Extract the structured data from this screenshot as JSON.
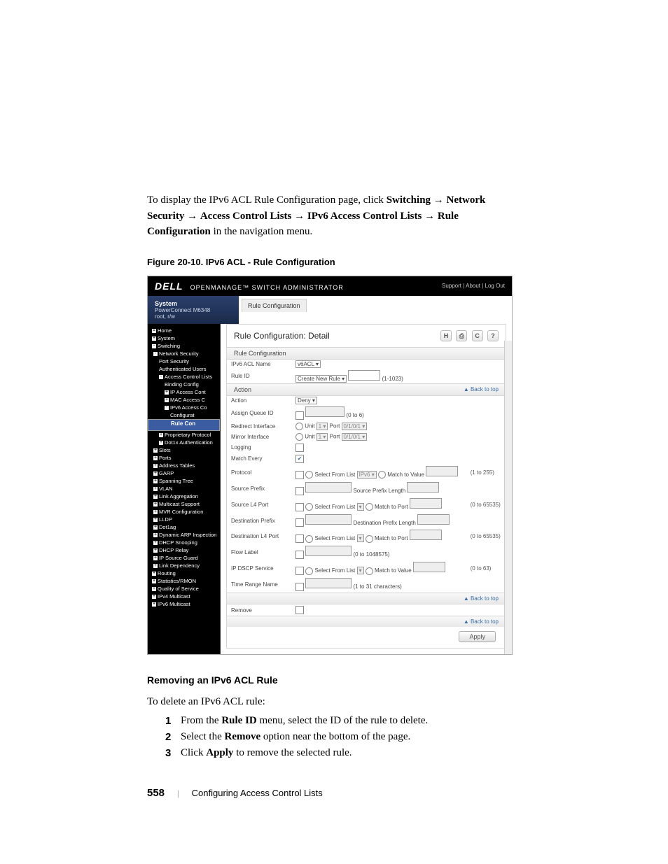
{
  "intro": {
    "line1_prefix": "To display the IPv6 ACL Rule Configuration page, click ",
    "switching": "Switching",
    "arrow": " → ",
    "ns": "Network Security",
    "acl": "Access Control Lists",
    "ipv6": "IPv6 Access Control Lists",
    "rc": "Rule Configuration",
    "suffix": " in the navigation menu."
  },
  "figure_caption": "Figure 20-10.    IPv6 ACL - Rule Configuration",
  "shot": {
    "logo": "DELL",
    "mast": "OPENMANAGE™ SWITCH ADMINISTRATOR",
    "toplinks": "Support | About | Log Out",
    "sys_title": "System",
    "sys_sub": "PowerConnect M6348\nroot, r/w",
    "crumb": "Rule Configuration",
    "panel_title": "Rule Configuration: Detail",
    "icons": {
      "h": "H",
      "print": "⎙",
      "refresh": "C",
      "help": "?"
    },
    "sec1": "Rule Configuration",
    "aclname_label": "IPv6 ACL Name",
    "aclname_value": "v6ACL",
    "ruleid_label": "Rule ID",
    "ruleid_value": "Create New Rule",
    "ruleid_hint": "(1-1023)",
    "sec2": "Action",
    "back_to_top": "▲ Back to top",
    "rows": {
      "action": {
        "label": "Action",
        "value": "Deny"
      },
      "assign_q": {
        "label": "Assign Queue ID",
        "hint": "(0 to 6)"
      },
      "redir": {
        "label": "Redirect Interface",
        "unit": "Unit",
        "port": "Port",
        "portval": "0/1/0/1"
      },
      "mirror": {
        "label": "Mirror Interface",
        "unit": "Unit",
        "port": "Port",
        "portval": "0/1/0/1"
      },
      "logging": {
        "label": "Logging"
      },
      "matchevery": {
        "label": "Match Every"
      },
      "protocol": {
        "label": "Protocol",
        "sfl": "Select From List",
        "sflval": "IPv6",
        "mtv": "Match to Value",
        "hint": "(1 to 255)"
      },
      "srcprefix": {
        "label": "Source Prefix",
        "lenlabel": "Source Prefix Length"
      },
      "srcl4": {
        "label": "Source L4 Port",
        "sfl": "Select From List",
        "mtp": "Match to Port",
        "hint": "(0 to 65535)"
      },
      "dstprefix": {
        "label": "Destination Prefix",
        "lenlabel": "Destination Prefix Length"
      },
      "dstl4": {
        "label": "Destination L4 Port",
        "sfl": "Select From List",
        "mtp": "Match to Port",
        "hint": "(0 to 65535)"
      },
      "flowlabel": {
        "label": "Flow Label",
        "hint": "(0 to 1048575)"
      },
      "ipdscp": {
        "label": "IP DSCP Service",
        "sfl": "Select From List",
        "mtv": "Match to Value",
        "hint": "(0 to 63)"
      },
      "timerange": {
        "label": "Time Range Name",
        "hint": "(1 to 31 characters)"
      }
    },
    "remove_label": "Remove",
    "apply": "Apply",
    "nav": [
      {
        "t": "Home",
        "l": 0,
        "sq": "="
      },
      {
        "t": "System",
        "l": 0,
        "sq": "+"
      },
      {
        "t": "Switching",
        "l": 0,
        "sq": "-"
      },
      {
        "t": "Network Security",
        "l": 1,
        "sq": "-"
      },
      {
        "t": "Port Security",
        "l": 2
      },
      {
        "t": "Authenticated Users",
        "l": 2
      },
      {
        "t": "Access Control Lists",
        "l": 2,
        "sq": "-"
      },
      {
        "t": "Binding Config",
        "l": 3
      },
      {
        "t": "IP Access Cont",
        "l": 3,
        "sq": "+"
      },
      {
        "t": "MAC Access C",
        "l": 3,
        "sq": "+"
      },
      {
        "t": "IPv6 Access Co",
        "l": 3,
        "sq": "-"
      },
      {
        "t": "Configurat",
        "l": 4
      },
      {
        "t": "Rule Con",
        "l": 4,
        "sel": true
      },
      {
        "t": "Proprietary Protocol",
        "l": 2,
        "sq": "+"
      },
      {
        "t": "Dot1x Authentication",
        "l": 2,
        "sq": "+"
      },
      {
        "t": "Slots",
        "l": 1,
        "sq": "+"
      },
      {
        "t": "Ports",
        "l": 1,
        "sq": "+"
      },
      {
        "t": "Address Tables",
        "l": 1,
        "sq": "+"
      },
      {
        "t": "GARP",
        "l": 1,
        "sq": "+"
      },
      {
        "t": "Spanning Tree",
        "l": 1,
        "sq": "+"
      },
      {
        "t": "VLAN",
        "l": 1,
        "sq": "+"
      },
      {
        "t": "Link Aggregation",
        "l": 1,
        "sq": "+"
      },
      {
        "t": "Multicast Support",
        "l": 1,
        "sq": "+"
      },
      {
        "t": "MVR Configuration",
        "l": 1,
        "sq": "+"
      },
      {
        "t": "LLDP",
        "l": 1,
        "sq": "+"
      },
      {
        "t": "Dot1ag",
        "l": 1,
        "sq": "+"
      },
      {
        "t": "Dynamic ARP Inspection",
        "l": 1,
        "sq": "+"
      },
      {
        "t": "DHCP Snooping",
        "l": 1,
        "sq": "+"
      },
      {
        "t": "DHCP Relay",
        "l": 1,
        "sq": "+"
      },
      {
        "t": "IP Source Guard",
        "l": 1,
        "sq": "+"
      },
      {
        "t": "Link Dependency",
        "l": 1,
        "sq": "+"
      },
      {
        "t": "Routing",
        "l": 0,
        "sq": "+"
      },
      {
        "t": "Statistics/RMON",
        "l": 0,
        "sq": "+"
      },
      {
        "t": "Quality of Service",
        "l": 0,
        "sq": "+"
      },
      {
        "t": "IPv4 Multicast",
        "l": 0,
        "sq": "+"
      },
      {
        "t": "IPv6 Multicast",
        "l": 0,
        "sq": "+"
      }
    ]
  },
  "removing": {
    "heading": "Removing an IPv6 ACL Rule",
    "lead": "To delete an IPv6 ACL rule:",
    "steps": [
      {
        "pre": "From the ",
        "b": "Rule ID",
        "post": " menu, select the ID of the rule to delete."
      },
      {
        "pre": "Select the ",
        "b": "Remove",
        "post": " option near the bottom of the page."
      },
      {
        "pre": "Click ",
        "b": "Apply",
        "post": " to remove the selected rule."
      }
    ]
  },
  "footer": {
    "page": "558",
    "section": "Configuring Access Control Lists"
  }
}
